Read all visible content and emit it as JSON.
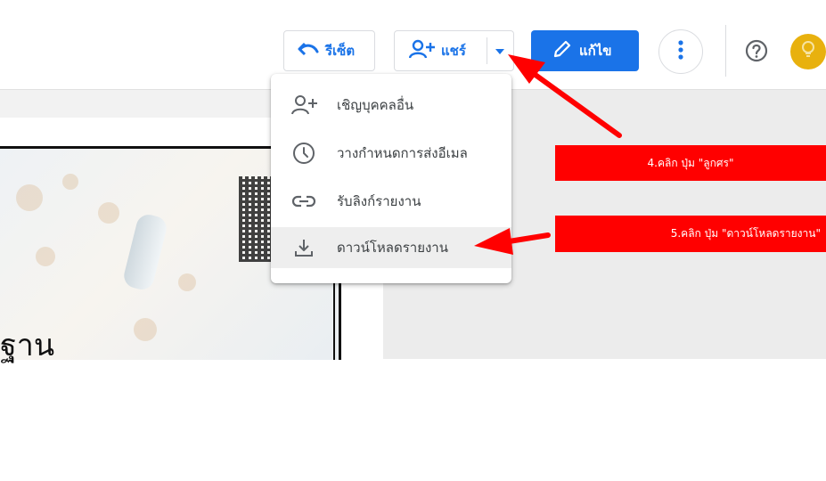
{
  "toolbar": {
    "reset_label": "รีเซ็ต",
    "share_label": "แชร์",
    "edit_label": "แก้ไข"
  },
  "share_menu": {
    "items": [
      {
        "label": "เชิญบุคคลอื่น",
        "icon": "add-person-icon"
      },
      {
        "label": "วางกำหนดการส่งอีเมล",
        "icon": "clock-icon"
      },
      {
        "label": "รับลิงก์รายงาน",
        "icon": "link-icon"
      },
      {
        "label": "ดาวน์โหลดรายงาน",
        "icon": "download-icon"
      }
    ]
  },
  "report": {
    "title_fragment": "ฐาน"
  },
  "annotations": {
    "step4": "4.คลิก ปุ่ม \"ลูกศร\"",
    "step5": "5.คลิก ปุ่ม \"ดาวน์โหลดรายงาน\""
  },
  "colors": {
    "accent": "#1a73e8",
    "annotation": "#ff0000",
    "avatar": "#e8b10e"
  }
}
